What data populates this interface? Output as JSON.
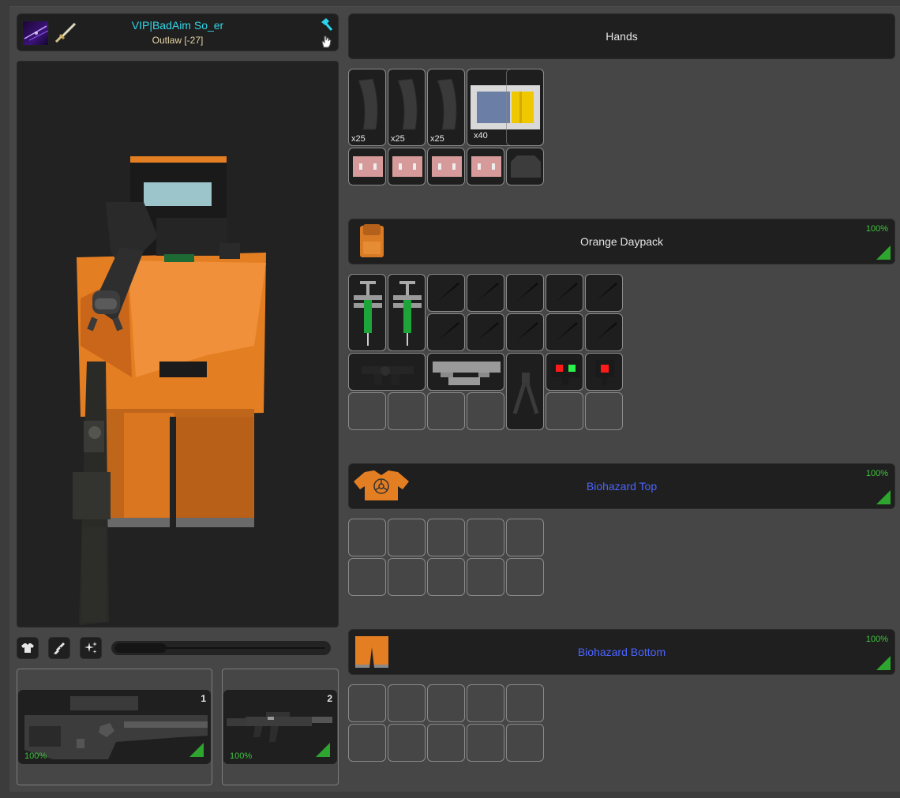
{
  "player": {
    "name": "VIP|BadAim So_er",
    "reputation": "Outlaw [-27]"
  },
  "colors": {
    "name": "#33d6e8",
    "reputation": "#e6d6a6",
    "durability": "#3fc43f",
    "blue_item": "#4b64ff",
    "white_item": "#e6e6e6",
    "accent_orange": "#e47e22"
  },
  "toolbar": {
    "icons": [
      "shirt-icon",
      "rifle-icon",
      "sparkle-icon"
    ],
    "zoom_level": 0.22
  },
  "weapons": [
    {
      "slot": "1",
      "durability": "100%",
      "icon": "sniper-rifle-icon"
    },
    {
      "slot": "2",
      "durability": "100%",
      "icon": "assault-rifle-icon"
    }
  ],
  "hands": {
    "title": "Hands",
    "items": [
      {
        "icon": "magazine-icon",
        "qty": "x25"
      },
      {
        "icon": "magazine-icon",
        "qty": "x25"
      },
      {
        "icon": "magazine-icon",
        "qty": "x25"
      },
      {
        "icon": "ammo-box-icon",
        "qty": "x40"
      },
      {
        "icon": "bandage-icon"
      },
      {
        "icon": "bandage-icon"
      },
      {
        "icon": "bandage-icon"
      },
      {
        "icon": "bandage-icon"
      },
      {
        "icon": "armor-plate-icon"
      }
    ]
  },
  "backpack": {
    "title": "Orange Daypack",
    "durability": "100%",
    "icon": "backpack-icon",
    "items": [
      {
        "icon": "syringe-icon"
      },
      {
        "icon": "syringe-icon"
      },
      {
        "icon": "grip-icon"
      },
      {
        "icon": "scope-icon"
      },
      {
        "icon": "bipod-icon"
      },
      {
        "icon": "laser-sight-icon"
      },
      {
        "icon": "red-dot-icon"
      }
    ]
  },
  "shirt": {
    "title": "Biohazard Top",
    "durability": "100%",
    "icon": "biohazard-shirt-icon"
  },
  "pants": {
    "title": "Biohazard Bottom",
    "durability": "100%",
    "icon": "pants-icon"
  }
}
